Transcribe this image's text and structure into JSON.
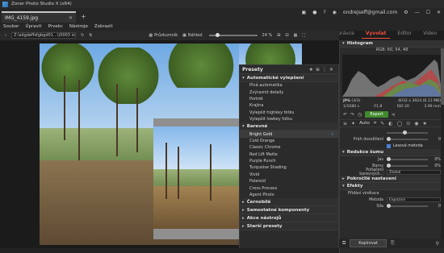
{
  "window": {
    "title": "Zoner Photo Studio X (x64)"
  },
  "tabs": [
    {
      "label": "IMG_4159.jpg"
    }
  ],
  "account": {
    "email": "ondrejseff@gmail.com"
  },
  "menu": [
    "Soubor",
    "Úpravit",
    "Prvekc",
    "Nástroje",
    "Zobrazit"
  ],
  "modes": {
    "items": [
      "Správce",
      "Vyvolat",
      "Editor",
      "Video"
    ],
    "active": "Vyvolat"
  },
  "toolbar": {
    "path": "Z:\\sdgdeffsfgbgd01...\\(0003 zone)",
    "view1": "Průzkumník",
    "view2": "Náhled",
    "zoom": "24 %"
  },
  "presets": {
    "title": "Presety",
    "groups": [
      {
        "name": "Automatické vylepšení",
        "expanded": true,
        "items": [
          "Plná automatika",
          "Zvýraznit detaily",
          "Portrét",
          "Krajina",
          "Vylepšit highkey fotku",
          "Vylepšit lowkey fotku"
        ]
      },
      {
        "name": "Barevné",
        "expanded": true,
        "items": [
          "Bright Gold",
          "Cold Orange",
          "Classic Chrome",
          "Red Lift Matte",
          "Purple Punch",
          "Turquoise Shading",
          "Vivid",
          "Polaroid",
          "Cross Process",
          "Agent Photo"
        ],
        "selected": "Bright Gold"
      },
      {
        "name": "Černobílé",
        "expanded": false,
        "items": []
      },
      {
        "name": "Samostatné komponenty",
        "expanded": false,
        "items": []
      },
      {
        "name": "Akce nástrojů",
        "expanded": false,
        "items": []
      },
      {
        "name": "Starší presety",
        "expanded": false,
        "items": []
      }
    ]
  },
  "histogram": {
    "title": "Histogram",
    "rgb": "RGB: 60, 54, 48"
  },
  "info": {
    "format": "JPG",
    "index": "(3/3)",
    "dimensions": "4032 x 3024 (6.11 MB)",
    "shutter": "1/1080 s",
    "aperture": "F1.8",
    "iso": "ISO 20",
    "focal": "3.99 mm"
  },
  "actions": {
    "export": "Export"
  },
  "tools": {
    "auto": "Auto"
  },
  "adjust": {
    "depth_label": "Práh dosvětlení",
    "depth_value": "0",
    "local_method": "Lesová metoda",
    "noise_section": "Redukce šumu",
    "jas_label": "Jas",
    "jas_value": "0%",
    "barvy_label": "Barvy",
    "barvy_value": "0%",
    "detail_label": "Potlačení barevných...",
    "detail_value": "Žádné",
    "advanced": "Pokročilé nastavení",
    "effects_section": "Efekty",
    "vignette_label": "Přidání vinětace",
    "method_label": "Metoda",
    "method_value": "Expozice",
    "strength_label": "Síla",
    "strength_value": "0"
  },
  "bottom": {
    "copy": "Kopírovat"
  }
}
